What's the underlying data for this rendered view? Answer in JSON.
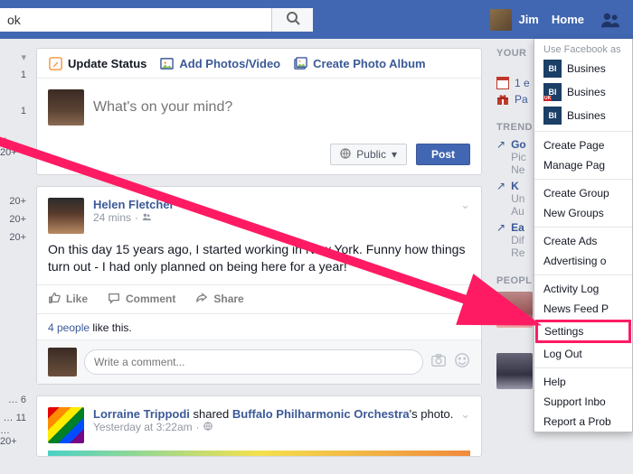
{
  "topbar": {
    "search_value": "ok",
    "user_name": "Jim",
    "home_label": "Home"
  },
  "composer": {
    "tab_status": "Update Status",
    "tab_photos": "Add Photos/Video",
    "tab_album": "Create Photo Album",
    "placeholder": "What's on your mind?",
    "privacy_label": "Public",
    "post_label": "Post"
  },
  "story1": {
    "author": "Helen Fletcher",
    "time": "24 mins",
    "body": "On this day 15 years ago, I started working in New York. Funny how things turn out - I had only planned on being here for a year!",
    "like": "Like",
    "comment": "Comment",
    "share": "Share",
    "like_count_prefix": "4 people",
    "like_suffix": " like this.",
    "comment_placeholder": "Write a comment..."
  },
  "story2": {
    "author": "Lorraine Trippodi",
    "shared_text": " shared ",
    "shared_entity": "Buffalo Philharmonic Orchestra",
    "shared_suffix": "'s photo.",
    "time": "Yesterday at 3:22am"
  },
  "left": {
    "r1": "1",
    "r2": "1",
    "r3": "K 20+",
    "r4": "20+",
    "r5": "20+",
    "r6": "20+",
    "r7": "… 6",
    "r8": "… 11",
    "r9": "… 20+"
  },
  "right": {
    "header_your": "YOUR",
    "event1": "1 e",
    "event2": "Pa",
    "header_trend": "TREND",
    "t1a": "Go",
    "t1b": "Pic",
    "t1c": "Ne",
    "t2a": "K",
    "t2b": "Un",
    "t2c": "Au",
    "t3a": "Ea",
    "t3b": "Dif",
    "t3c": "Re",
    "header_people": "PEOPL"
  },
  "menu": {
    "header": "Use Facebook as",
    "page1": "Busines",
    "page2": "Busines",
    "page3": "Busines",
    "create_page": "Create Page",
    "manage_pages": "Manage Pag",
    "create_group": "Create Group",
    "new_groups": "New Groups",
    "create_ads": "Create Ads",
    "advertising": "Advertising o",
    "activity_log": "Activity Log",
    "news_feed": "News Feed P",
    "settings": "Settings",
    "log_out": "Log Out",
    "help": "Help",
    "support_inbox": "Support Inbo",
    "report": "Report a Prob"
  }
}
